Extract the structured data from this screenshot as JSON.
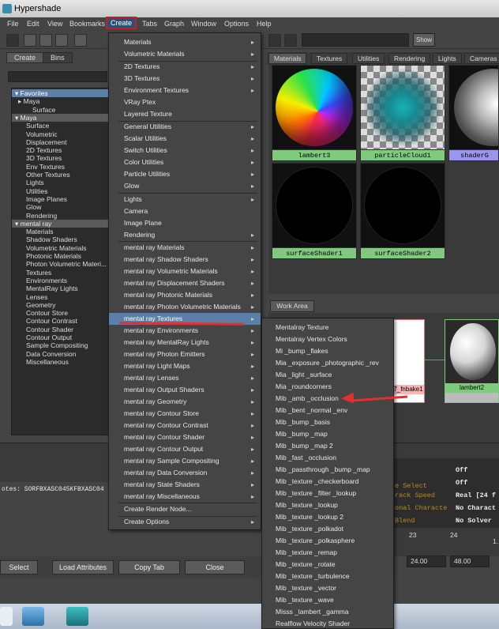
{
  "window": {
    "title": "Hypershade"
  },
  "menubar": [
    "File",
    "Edit",
    "View",
    "Bookmarks",
    "Create",
    "Tabs",
    "Graph",
    "Window",
    "Options",
    "Help"
  ],
  "toolbar": {
    "show_label": "Show"
  },
  "left_panel": {
    "tabs": [
      "Create",
      "Bins"
    ],
    "tree": [
      {
        "label": "▾ Favorites",
        "indent": 0,
        "style": "sel"
      },
      {
        "label": "▸ Maya",
        "indent": 4,
        "style": ""
      },
      {
        "label": "Surface",
        "indent": 22,
        "style": ""
      },
      {
        "label": "▾ Maya",
        "indent": 0,
        "style": "hdr"
      },
      {
        "label": "Surface",
        "indent": 14,
        "style": ""
      },
      {
        "label": "Volumetric",
        "indent": 14,
        "style": ""
      },
      {
        "label": "Displacement",
        "indent": 14,
        "style": ""
      },
      {
        "label": "2D Textures",
        "indent": 14,
        "style": ""
      },
      {
        "label": "3D Textures",
        "indent": 14,
        "style": ""
      },
      {
        "label": "Env Textures",
        "indent": 14,
        "style": ""
      },
      {
        "label": "Other Textures",
        "indent": 14,
        "style": ""
      },
      {
        "label": "Lights",
        "indent": 14,
        "style": ""
      },
      {
        "label": "Utilities",
        "indent": 14,
        "style": ""
      },
      {
        "label": "Image Planes",
        "indent": 14,
        "style": ""
      },
      {
        "label": "Glow",
        "indent": 14,
        "style": ""
      },
      {
        "label": "Rendering",
        "indent": 14,
        "style": ""
      },
      {
        "label": "▾ mental ray",
        "indent": 0,
        "style": "hdr"
      },
      {
        "label": "Materials",
        "indent": 14,
        "style": ""
      },
      {
        "label": "Shadow Shaders",
        "indent": 14,
        "style": ""
      },
      {
        "label": "Volumetric Materials",
        "indent": 14,
        "style": ""
      },
      {
        "label": "Photonic Materials",
        "indent": 14,
        "style": ""
      },
      {
        "label": "Photon Volumetric Materi...",
        "indent": 14,
        "style": ""
      },
      {
        "label": "Textures",
        "indent": 14,
        "style": ""
      },
      {
        "label": "Environments",
        "indent": 14,
        "style": ""
      },
      {
        "label": "MentalRay Lights",
        "indent": 14,
        "style": ""
      },
      {
        "label": "Lenses",
        "indent": 14,
        "style": ""
      },
      {
        "label": "Geometry",
        "indent": 14,
        "style": ""
      },
      {
        "label": "Contour Store",
        "indent": 14,
        "style": ""
      },
      {
        "label": "Contour Contrast",
        "indent": 14,
        "style": ""
      },
      {
        "label": "Contour Shader",
        "indent": 14,
        "style": ""
      },
      {
        "label": "Contour Output",
        "indent": 14,
        "style": ""
      },
      {
        "label": "Sample Compositing",
        "indent": 14,
        "style": ""
      },
      {
        "label": "Data Conversion",
        "indent": 14,
        "style": ""
      },
      {
        "label": "Miscellaneous",
        "indent": 14,
        "style": ""
      }
    ]
  },
  "right_tabs": [
    "Materials",
    "Textures",
    "Utilities",
    "Rendering",
    "Lights",
    "Cameras"
  ],
  "swatches": [
    {
      "label": "lambert3",
      "kind": "rainbow"
    },
    {
      "label": "particleCloud1",
      "kind": "cloud"
    },
    {
      "label": "shaderG",
      "kind": "grey"
    },
    {
      "label": "surfaceShader1",
      "kind": "black"
    },
    {
      "label": "surfaceShader2",
      "kind": "black"
    }
  ],
  "work_area": {
    "tab": "Work Area",
    "node_left_label": "7_fnbake1",
    "node_right_label": "lambert2"
  },
  "notes_line": "otes: SORFBXASC045KFBXASC04",
  "attributes": [
    {
      "key": "",
      "value": "Off"
    },
    {
      "key": "e Select",
      "value": "Off"
    },
    {
      "key": "rack Speed",
      "value": "Real [24 f"
    },
    {
      "key": "onal Characte",
      "value": "No Charact"
    },
    {
      "key": "Blend",
      "value": "No Solver"
    }
  ],
  "timeline": {
    "tick1": "23",
    "tick2": "24",
    "tick3": "1.",
    "field1": "24.00",
    "field2": "48.00"
  },
  "bottom_buttons": [
    "Select",
    "Load Attributes",
    "Copy Tab",
    "Close"
  ],
  "create_menu": [
    {
      "label": "Materials",
      "sub": true
    },
    {
      "label": "Volumetric Materials",
      "sub": true
    },
    {
      "sep": true
    },
    {
      "label": "2D Textures",
      "sub": true
    },
    {
      "label": "3D Textures",
      "sub": true
    },
    {
      "label": "Environment Textures",
      "sub": true
    },
    {
      "label": "VRay Ptex",
      "sub": false
    },
    {
      "label": "Layered Texture",
      "sub": false
    },
    {
      "sep": true
    },
    {
      "label": "General Utilities",
      "sub": true
    },
    {
      "label": "Scalar Utilities",
      "sub": true
    },
    {
      "label": "Switch Utilities",
      "sub": true
    },
    {
      "label": "Color Utilities",
      "sub": true
    },
    {
      "label": "Particle Utilities",
      "sub": true
    },
    {
      "label": "Glow",
      "sub": true
    },
    {
      "sep": true
    },
    {
      "label": "Lights",
      "sub": true
    },
    {
      "label": "Camera",
      "sub": false
    },
    {
      "label": "Image Plane",
      "sub": false
    },
    {
      "label": "Rendering",
      "sub": true
    },
    {
      "sep": true
    },
    {
      "label": "mental ray Materials",
      "sub": true
    },
    {
      "label": "mental ray Shadow Shaders",
      "sub": true
    },
    {
      "label": "mental ray Volumetric Materials",
      "sub": true
    },
    {
      "label": "mental ray Displacement Shaders",
      "sub": true
    },
    {
      "label": "mental ray Photonic Materials",
      "sub": true
    },
    {
      "label": "mental ray Photon Volumetric Materials",
      "sub": true
    },
    {
      "label": "mental ray Textures",
      "sub": true,
      "hl": true
    },
    {
      "label": "mental ray Environments",
      "sub": true
    },
    {
      "label": "mental ray MentalRay Lights",
      "sub": true
    },
    {
      "label": "mental ray Photon Emitters",
      "sub": true
    },
    {
      "label": "mental ray Light Maps",
      "sub": true
    },
    {
      "label": "mental ray Lenses",
      "sub": true
    },
    {
      "label": "mental ray Output Shaders",
      "sub": true
    },
    {
      "label": "mental ray Geometry",
      "sub": true
    },
    {
      "label": "mental ray Contour Store",
      "sub": true
    },
    {
      "label": "mental ray Contour Contrast",
      "sub": true
    },
    {
      "label": "mental ray Contour Shader",
      "sub": true
    },
    {
      "label": "mental ray Contour Output",
      "sub": true
    },
    {
      "label": "mental ray Sample Compositing",
      "sub": true
    },
    {
      "label": "mental ray Data Conversion",
      "sub": true
    },
    {
      "label": "mental ray State Shaders",
      "sub": true
    },
    {
      "label": "mental ray Miscellaneous",
      "sub": true
    },
    {
      "sep": true
    },
    {
      "label": "Create Render Node...",
      "sub": false
    },
    {
      "sep": true
    },
    {
      "label": "Create Options",
      "sub": true
    }
  ],
  "textures_submenu": [
    "Mentalray Texture",
    "Mentalray Vertex Colors",
    "Mi _bump _flakes",
    "Mia _exposure _photographic _rev",
    "Mia _light _surface",
    "Mia _roundcorners",
    "Mib _amb _occlusion",
    "Mib _bent _normal _env",
    "Mib _bump _basis",
    "Mib _bump _map",
    "Mib _bump _map 2",
    "Mib _fast _occlusion",
    "Mib _passthrough _bump _map",
    "Mib _texture _checkerboard",
    "Mib _texture _filter _lookup",
    "Mib _texture _lookup",
    "Mib _texture _lookup 2",
    "Mib _texture _polkadot",
    "Mib _texture _polkasphere",
    "Mib _texture _remap",
    "Mib _texture _rotate",
    "Mib _texture _turbulence",
    "Mib _texture _vector",
    "Mib _texture _wave",
    "Misss _lambert _gamma",
    "Realflow Velocity Shader"
  ]
}
